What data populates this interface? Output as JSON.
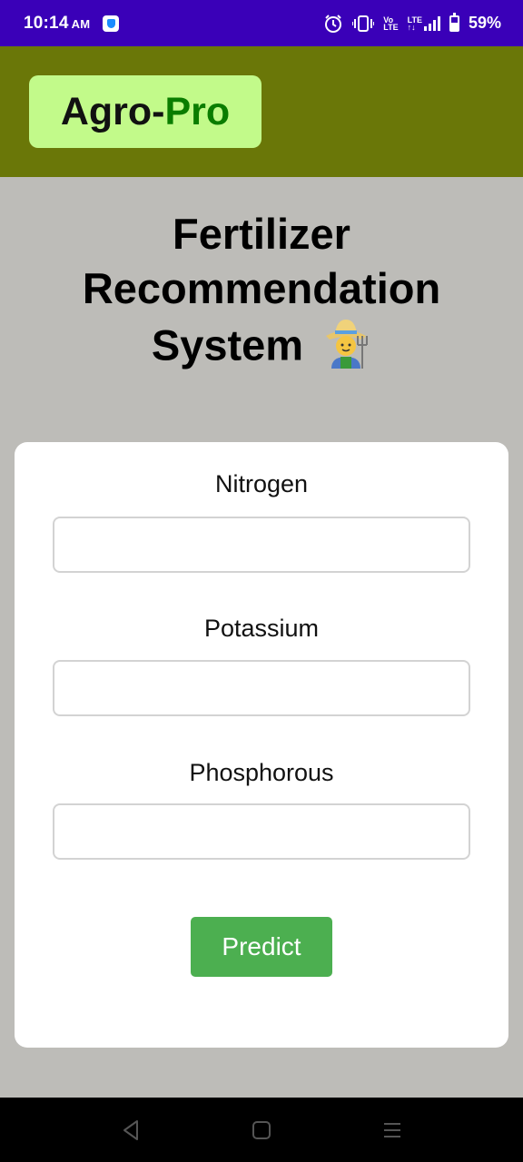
{
  "status_bar": {
    "time": "10:14",
    "ampm": "AM",
    "battery": "59%",
    "icons": [
      "vpn-icon",
      "alarm-icon",
      "vibrate-icon",
      "volte-icon",
      "lte-signal-icon",
      "battery-icon"
    ]
  },
  "header": {
    "logo_part1": "Agro-",
    "logo_part2": "Pro",
    "colors": {
      "header_bg": "#6a7708",
      "logo_bg": "#c2fa8a",
      "logo_accent": "#0a7d00"
    }
  },
  "main": {
    "title_line1": "Fertilizer",
    "title_line2": "Recommendation",
    "title_line3": "System",
    "title_icon": "farmer-emoji-icon"
  },
  "form": {
    "fields": [
      {
        "label": "Nitrogen",
        "value": "",
        "placeholder": ""
      },
      {
        "label": "Potassium",
        "value": "",
        "placeholder": ""
      },
      {
        "label": "Phosphorous",
        "value": "",
        "placeholder": ""
      }
    ],
    "submit_label": "Predict",
    "button_color": "#4caf50"
  },
  "nav_bar": {
    "icons": [
      "back-icon",
      "home-icon",
      "recents-icon"
    ]
  }
}
